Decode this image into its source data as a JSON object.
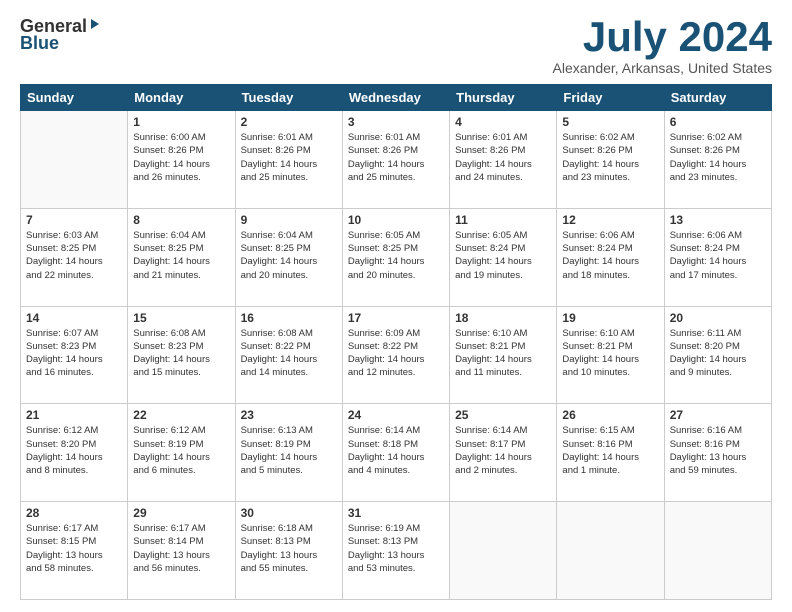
{
  "logo": {
    "general": "General",
    "blue": "Blue"
  },
  "title": "July 2024",
  "location": "Alexander, Arkansas, United States",
  "days_header": [
    "Sunday",
    "Monday",
    "Tuesday",
    "Wednesday",
    "Thursday",
    "Friday",
    "Saturday"
  ],
  "weeks": [
    [
      {
        "day": "",
        "info": ""
      },
      {
        "day": "1",
        "info": "Sunrise: 6:00 AM\nSunset: 8:26 PM\nDaylight: 14 hours\nand 26 minutes."
      },
      {
        "day": "2",
        "info": "Sunrise: 6:01 AM\nSunset: 8:26 PM\nDaylight: 14 hours\nand 25 minutes."
      },
      {
        "day": "3",
        "info": "Sunrise: 6:01 AM\nSunset: 8:26 PM\nDaylight: 14 hours\nand 25 minutes."
      },
      {
        "day": "4",
        "info": "Sunrise: 6:01 AM\nSunset: 8:26 PM\nDaylight: 14 hours\nand 24 minutes."
      },
      {
        "day": "5",
        "info": "Sunrise: 6:02 AM\nSunset: 8:26 PM\nDaylight: 14 hours\nand 23 minutes."
      },
      {
        "day": "6",
        "info": "Sunrise: 6:02 AM\nSunset: 8:26 PM\nDaylight: 14 hours\nand 23 minutes."
      }
    ],
    [
      {
        "day": "7",
        "info": "Sunrise: 6:03 AM\nSunset: 8:25 PM\nDaylight: 14 hours\nand 22 minutes."
      },
      {
        "day": "8",
        "info": "Sunrise: 6:04 AM\nSunset: 8:25 PM\nDaylight: 14 hours\nand 21 minutes."
      },
      {
        "day": "9",
        "info": "Sunrise: 6:04 AM\nSunset: 8:25 PM\nDaylight: 14 hours\nand 20 minutes."
      },
      {
        "day": "10",
        "info": "Sunrise: 6:05 AM\nSunset: 8:25 PM\nDaylight: 14 hours\nand 20 minutes."
      },
      {
        "day": "11",
        "info": "Sunrise: 6:05 AM\nSunset: 8:24 PM\nDaylight: 14 hours\nand 19 minutes."
      },
      {
        "day": "12",
        "info": "Sunrise: 6:06 AM\nSunset: 8:24 PM\nDaylight: 14 hours\nand 18 minutes."
      },
      {
        "day": "13",
        "info": "Sunrise: 6:06 AM\nSunset: 8:24 PM\nDaylight: 14 hours\nand 17 minutes."
      }
    ],
    [
      {
        "day": "14",
        "info": "Sunrise: 6:07 AM\nSunset: 8:23 PM\nDaylight: 14 hours\nand 16 minutes."
      },
      {
        "day": "15",
        "info": "Sunrise: 6:08 AM\nSunset: 8:23 PM\nDaylight: 14 hours\nand 15 minutes."
      },
      {
        "day": "16",
        "info": "Sunrise: 6:08 AM\nSunset: 8:22 PM\nDaylight: 14 hours\nand 14 minutes."
      },
      {
        "day": "17",
        "info": "Sunrise: 6:09 AM\nSunset: 8:22 PM\nDaylight: 14 hours\nand 12 minutes."
      },
      {
        "day": "18",
        "info": "Sunrise: 6:10 AM\nSunset: 8:21 PM\nDaylight: 14 hours\nand 11 minutes."
      },
      {
        "day": "19",
        "info": "Sunrise: 6:10 AM\nSunset: 8:21 PM\nDaylight: 14 hours\nand 10 minutes."
      },
      {
        "day": "20",
        "info": "Sunrise: 6:11 AM\nSunset: 8:20 PM\nDaylight: 14 hours\nand 9 minutes."
      }
    ],
    [
      {
        "day": "21",
        "info": "Sunrise: 6:12 AM\nSunset: 8:20 PM\nDaylight: 14 hours\nand 8 minutes."
      },
      {
        "day": "22",
        "info": "Sunrise: 6:12 AM\nSunset: 8:19 PM\nDaylight: 14 hours\nand 6 minutes."
      },
      {
        "day": "23",
        "info": "Sunrise: 6:13 AM\nSunset: 8:19 PM\nDaylight: 14 hours\nand 5 minutes."
      },
      {
        "day": "24",
        "info": "Sunrise: 6:14 AM\nSunset: 8:18 PM\nDaylight: 14 hours\nand 4 minutes."
      },
      {
        "day": "25",
        "info": "Sunrise: 6:14 AM\nSunset: 8:17 PM\nDaylight: 14 hours\nand 2 minutes."
      },
      {
        "day": "26",
        "info": "Sunrise: 6:15 AM\nSunset: 8:16 PM\nDaylight: 14 hours\nand 1 minute."
      },
      {
        "day": "27",
        "info": "Sunrise: 6:16 AM\nSunset: 8:16 PM\nDaylight: 13 hours\nand 59 minutes."
      }
    ],
    [
      {
        "day": "28",
        "info": "Sunrise: 6:17 AM\nSunset: 8:15 PM\nDaylight: 13 hours\nand 58 minutes."
      },
      {
        "day": "29",
        "info": "Sunrise: 6:17 AM\nSunset: 8:14 PM\nDaylight: 13 hours\nand 56 minutes."
      },
      {
        "day": "30",
        "info": "Sunrise: 6:18 AM\nSunset: 8:13 PM\nDaylight: 13 hours\nand 55 minutes."
      },
      {
        "day": "31",
        "info": "Sunrise: 6:19 AM\nSunset: 8:13 PM\nDaylight: 13 hours\nand 53 minutes."
      },
      {
        "day": "",
        "info": ""
      },
      {
        "day": "",
        "info": ""
      },
      {
        "day": "",
        "info": ""
      }
    ]
  ]
}
